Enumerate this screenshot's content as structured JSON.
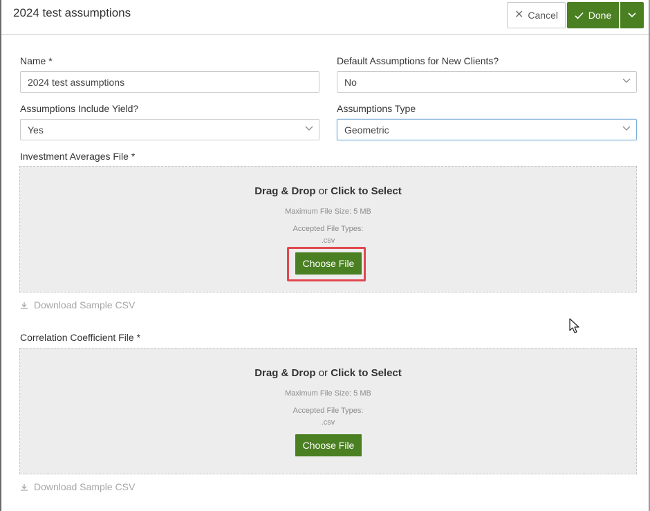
{
  "header": {
    "title": "2024 test assumptions",
    "cancel_label": "Cancel",
    "done_label": "Done"
  },
  "form": {
    "name": {
      "label": "Name *",
      "value": "2024 test assumptions"
    },
    "default_assumptions": {
      "label": "Default Assumptions for New Clients?",
      "value": "No"
    },
    "include_yield": {
      "label": "Assumptions Include Yield?",
      "value": "Yes"
    },
    "assumptions_type": {
      "label": "Assumptions Type",
      "value": "Geometric"
    }
  },
  "upload_investment": {
    "label": "Investment Averages File *",
    "drag_drop": "Drag & Drop",
    "or": "or",
    "click_select": "Click to Select",
    "max_size": "Maximum File Size: 5 MB",
    "accepted_label": "Accepted File Types:",
    "accepted_types": ".csv",
    "choose_label": "Choose File",
    "download_label": "Download Sample CSV"
  },
  "upload_correlation": {
    "label": "Correlation Coefficient File *",
    "drag_drop": "Drag & Drop",
    "or": "or",
    "click_select": "Click to Select",
    "max_size": "Maximum File Size: 5 MB",
    "accepted_label": "Accepted File Types:",
    "accepted_types": ".csv",
    "choose_label": "Choose File",
    "download_label": "Download Sample CSV"
  },
  "colors": {
    "primary_green": "#4a7f22",
    "highlight_red": "#e2474f",
    "focus_blue": "#7aaed8",
    "dropzone_bg": "#ededed"
  },
  "icons": [
    "close-icon",
    "check-icon",
    "chevron-down-icon",
    "download-icon",
    "mouse-cursor-icon"
  ]
}
